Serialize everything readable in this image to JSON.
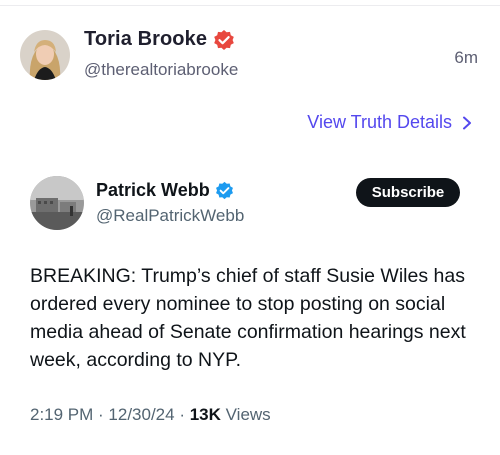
{
  "truth_post": {
    "author_name": "Toria Brooke",
    "author_handle": "@therealtoriabrooke",
    "time_ago": "6m",
    "details_link": "View Truth Details",
    "verified_color": "#e8483f",
    "link_color": "#5448ee"
  },
  "embedded_post": {
    "author_name": "Patrick Webb",
    "author_handle": "@RealPatrickWebb",
    "subscribe_label": "Subscribe",
    "body_text": "BREAKING: Trump’s chief of staff Susie Wiles has ordered every nominee to stop posting on social media ahead of Senate confirmation hearings next week, according to NYP.",
    "time": "2:19 PM",
    "separator": " · ",
    "date": "12/30/24",
    "views_count": "13K",
    "views_label": " Views",
    "verified_color": "#1d9bf0"
  }
}
